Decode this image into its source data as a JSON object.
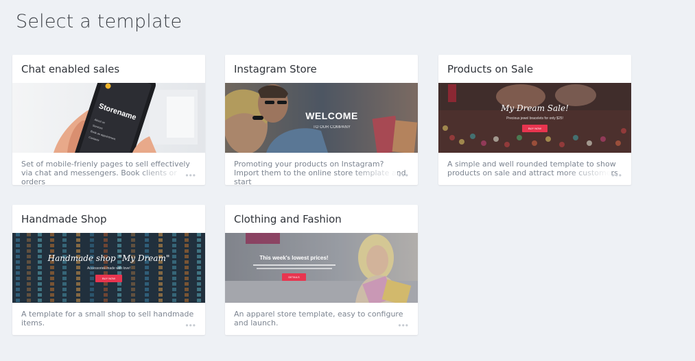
{
  "page": {
    "title": "Select a template"
  },
  "templates": [
    {
      "title": "Chat enabled sales",
      "description": "Set of mobile-frienly pages to sell effectively via chat and messengers. Book clients or orders",
      "thumb": {
        "brand": "Storename",
        "menu": [
          "About us",
          "Services",
          "Book an appointment",
          "Contacts"
        ]
      }
    },
    {
      "title": "Instagram Store",
      "description": "Promoting your products on Instagram? Import them to the online store template and start",
      "thumb": {
        "headline": "WELCOME",
        "sub": "TO OUR COMPANY"
      }
    },
    {
      "title": "Products on Sale",
      "description": "A simple and well rounded template to show products on sale and attract more customers",
      "thumb": {
        "headline": "My Dream Sale!",
        "sub": "Precious jewel bracelets for only $25!",
        "button": "BUY NOW"
      }
    },
    {
      "title": "Handmade Shop",
      "description": "A template for a small shop to sell handmade items.",
      "thumb": {
        "headline": "Handmade shop \"My Dream\"",
        "sub": "Accessories made with love!",
        "button": "BUY NOW"
      }
    },
    {
      "title": "Clothing and Fashion",
      "description": "An apparel store template, easy to configure and launch.",
      "thumb": {
        "headline": "This week's lowest prices!",
        "button": "DETAILS"
      }
    }
  ],
  "colors": {
    "background": "#eef1f5",
    "accent_button": "#e8354f",
    "more_dots": "#c6cbd2"
  },
  "icons": {
    "more": "ellipsis-icon"
  }
}
